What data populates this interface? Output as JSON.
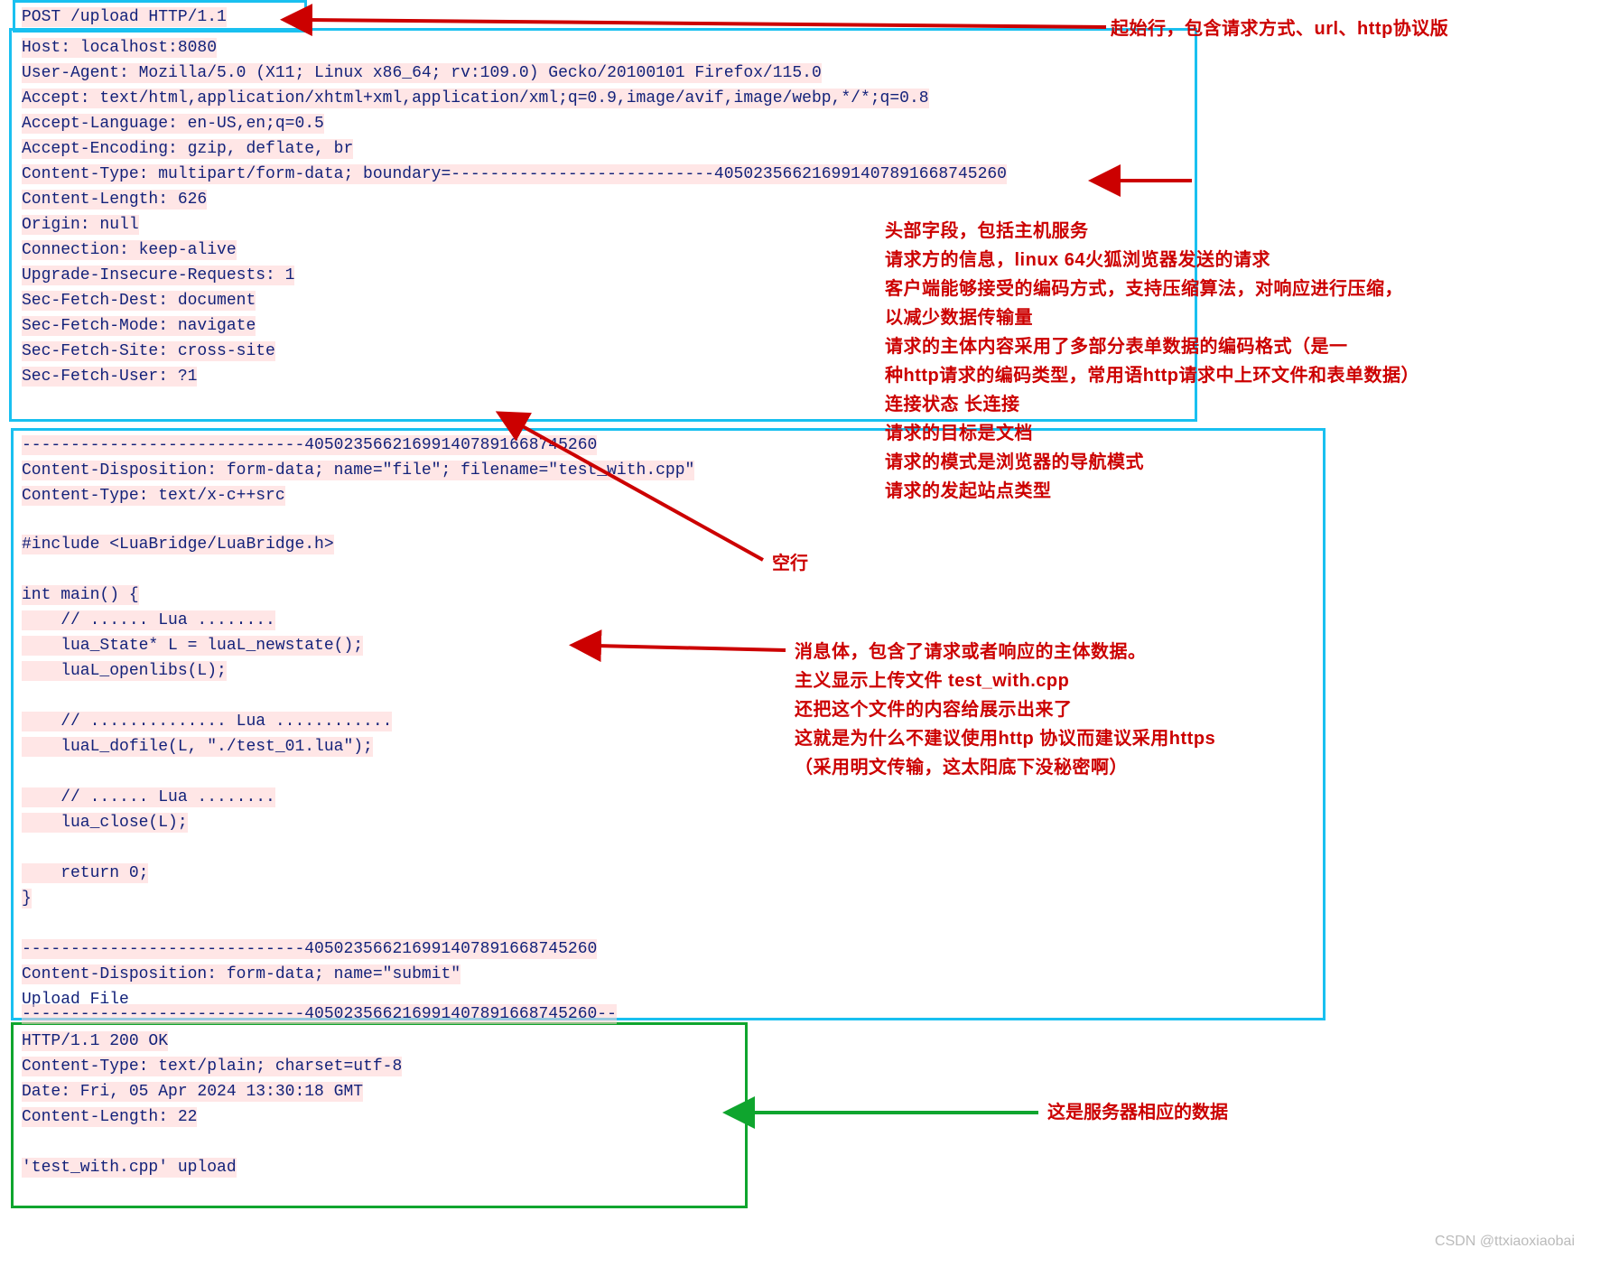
{
  "request": {
    "start_line": "POST /upload HTTP/1.1",
    "host": "Host: localhost:8080",
    "user_agent": "User-Agent: Mozilla/5.0 (X11; Linux x86_64; rv:109.0) Gecko/20100101 Firefox/115.0",
    "accept": "Accept: text/html,application/xhtml+xml,application/xml;q=0.9,image/avif,image/webp,*/*;q=0.8",
    "accept_language": "Accept-Language: en-US,en;q=0.5",
    "accept_encoding": "Accept-Encoding: gzip, deflate, br",
    "content_type": "Content-Type: multipart/form-data; boundary=---------------------------40502356621699140789166874­5260",
    "content_length": "Content-Length: 626",
    "origin": "Origin: null",
    "connection": "Connection: keep-alive",
    "upgrade": "Upgrade-Insecure-Requests: 1",
    "sfd": "Sec-Fetch-Dest: document",
    "sfm": "Sec-Fetch-Mode: navigate",
    "sfs": "Sec-Fetch-Site: cross-site",
    "sfu": "Sec-Fetch-User: ?1"
  },
  "body": {
    "boundary1": "-----------------------------405023566216991407891668745260",
    "cd_file": "Content-Disposition: form-data; name=\"file\"; filename=\"test_with.cpp\"",
    "ct_file": "Content-Type: text/x-c++src",
    "include": "#include <LuaBridge/LuaBridge.h>",
    "main_open": "int main() {",
    "c1": "    // ...... Lua ........",
    "l1": "    lua_State* L = luaL_newstate();",
    "l2": "    luaL_openlibs(L);",
    "c2": "    // .............. Lua ............",
    "l3": "    luaL_dofile(L, \"./test_01.lua\");",
    "c3": "    // ...... Lua ........",
    "l4": "    lua_close(L);",
    "ret": "    return 0;",
    "main_close": "}",
    "boundary2": "-----------------------------405023566216991407891668745260",
    "cd_submit": "Content-Disposition: form-data; name=\"submit\"",
    "upload_label": "Upload File",
    "boundary3": "-----------------------------405023566216991407891668745260--"
  },
  "response": {
    "status": "HTTP/1.1 200 OK",
    "ct": "Content-Type: text/plain; charset=utf-8",
    "date": "Date: Fri, 05 Apr 2024 13:30:18 GMT",
    "cl": "Content-Length: 22",
    "msg": "'test_with.cpp' upload"
  },
  "notes": {
    "start_line": "起始行，包含请求方式、url、http协议版",
    "headers1": "头部字段，包括主机服务",
    "headers2": "请求方的信息，linux 64火狐浏览器发送的请求",
    "headers3": "客户端能够接受的编码方式，支持压缩算法，对响应进行压缩，",
    "headers4": "以减少数据传输量",
    "headers5": "请求的主体内容采用了多部分表单数据的编码格式（是一",
    "headers6": "种http请求的编码类型，常用语http请求中上环文件和表单数据）",
    "headers7": "连接状态  长连接",
    "headers8": "请求的目标是文档",
    "headers9": "请求的模式是浏览器的导航模式",
    "headers10": "请求的发起站点类型",
    "empty_line": "空行",
    "body1": "消息体，包含了请求或者响应的主体数据。",
    "body2": "主义显示上传文件  test_with.cpp",
    "body3": "还把这个文件的内容给展示出来了",
    "body4": "这就是为什么不建议使用http 协议而建议采用https",
    "body5": "（采用明文传输，这太阳底下没秘密啊）",
    "response": "这是服务器相应的数据"
  },
  "watermark": "CSDN @ttxiaoxiaobai"
}
